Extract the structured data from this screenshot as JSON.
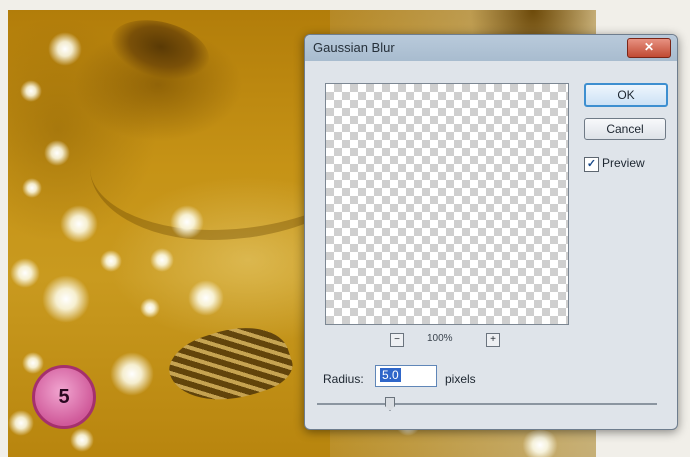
{
  "step_badge": "5",
  "dialog": {
    "title": "Gaussian Blur",
    "close_glyph": "✕",
    "ok_label": "OK",
    "cancel_label": "Cancel",
    "preview_checked": "✓",
    "preview_label": "Preview",
    "zoom_out": "−",
    "zoom_level": "100%",
    "zoom_in": "+",
    "radius_label": "Radius:",
    "radius_value": "5.0",
    "radius_unit": "pixels"
  },
  "colors": {
    "photo_tint": "#c69316",
    "dialog_bg": "#dfe4ea",
    "close_button": "#c14a33",
    "ok_focus": "#3e8fd0",
    "badge": "#d05a9a"
  },
  "icons": [
    "close-icon",
    "checkmark-icon",
    "zoom-out-icon",
    "zoom-in-icon",
    "slider-thumb"
  ]
}
